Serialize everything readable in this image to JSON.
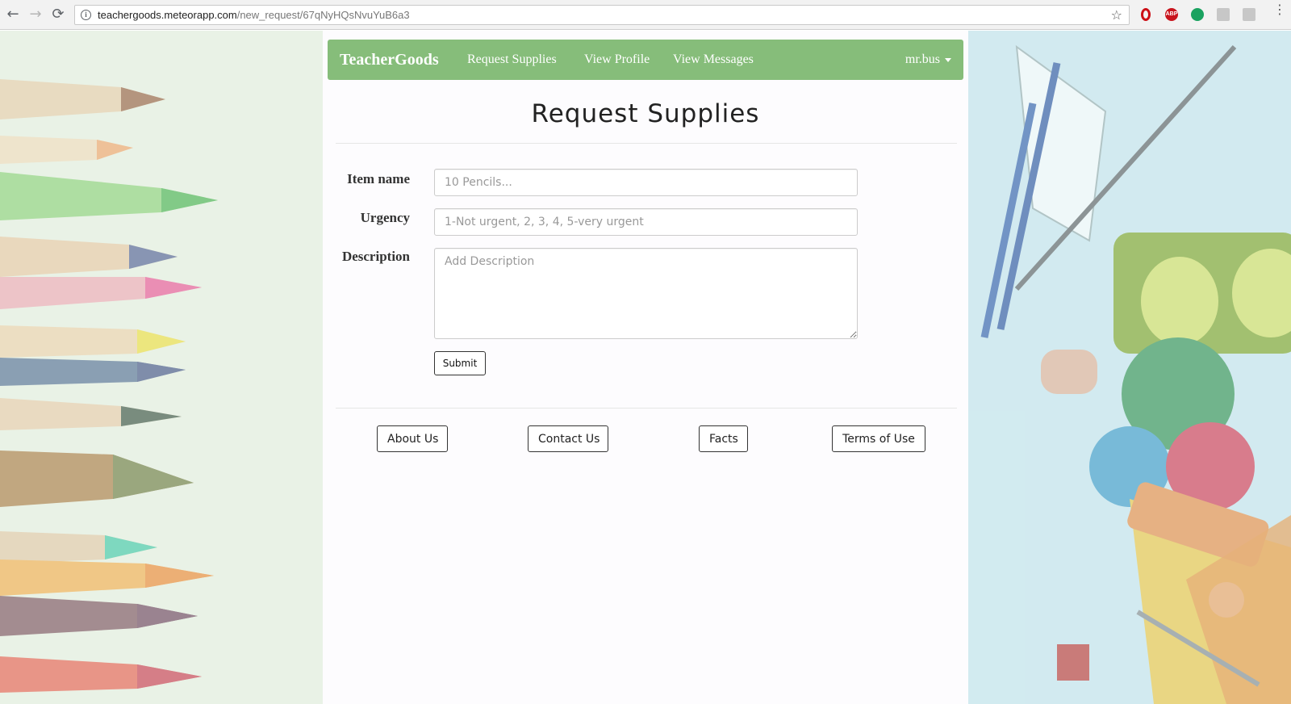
{
  "browser": {
    "url_host": "teachergoods.meteorapp.com",
    "url_path": "/new_request/67qNyHQsNvuYuB6a3",
    "extensions": [
      "opera-icon",
      "adblock-plus-icon",
      "green-extension-icon",
      "pdf-extension-icon",
      "grey-extension-icon"
    ],
    "abp_label": "ABP"
  },
  "navbar": {
    "brand": "TeacherGoods",
    "links": [
      "Request Supplies",
      "View Profile",
      "View Messages"
    ],
    "user": "mr.bus",
    "color": "#86bd7a"
  },
  "page": {
    "title": "Request Supplies"
  },
  "form": {
    "item_name": {
      "label": "Item name",
      "placeholder": "10 Pencils...",
      "value": ""
    },
    "urgency": {
      "label": "Urgency",
      "placeholder": "1-Not urgent, 2, 3, 4, 5-very urgent",
      "value": ""
    },
    "description": {
      "label": "Description",
      "placeholder": "Add Description",
      "value": ""
    },
    "submit_label": "Submit"
  },
  "footer": {
    "buttons": [
      "About Us",
      "Contact Us",
      "Facts",
      "Terms of Use"
    ]
  }
}
